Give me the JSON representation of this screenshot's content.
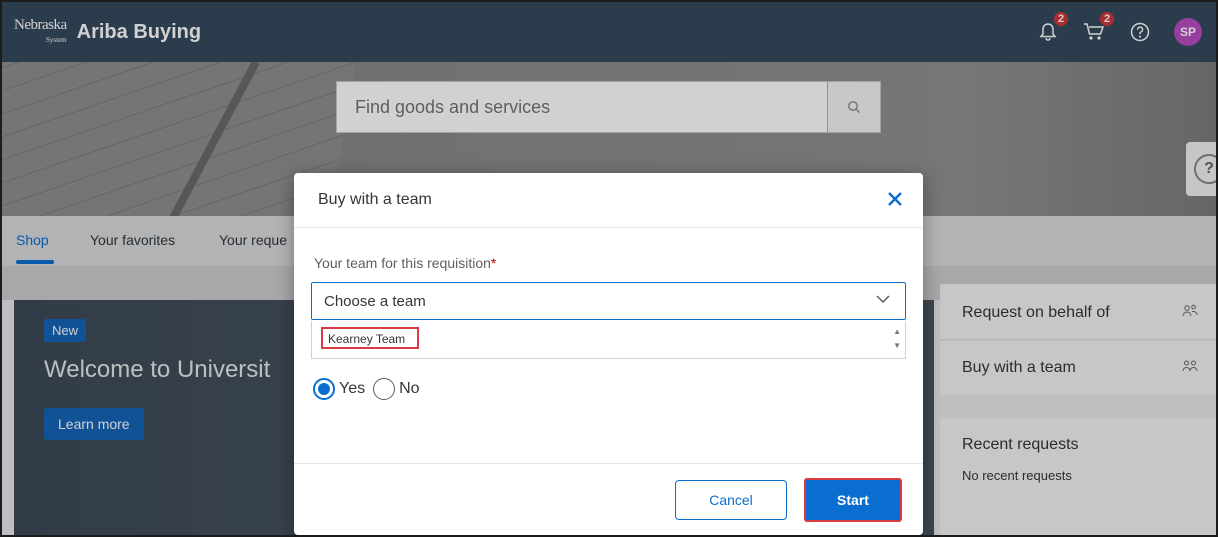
{
  "header": {
    "logo_text": "Nebraska",
    "logo_subtext": "System",
    "app_name": "Ariba Buying",
    "notifications_count": "2",
    "cart_count": "2",
    "avatar_initials": "SP"
  },
  "search": {
    "placeholder": "Find goods and services"
  },
  "nav": {
    "tabs": [
      "Shop",
      "Your favorites",
      "Your reque"
    ]
  },
  "banner": {
    "tag": "New",
    "welcome": "Welcome to Universit",
    "learn_more": "Learn more"
  },
  "right_panel": {
    "request_on_behalf": "Request on behalf of",
    "buy_with_team": "Buy with a team",
    "recent_title": "Recent requests",
    "recent_empty": "No recent requests"
  },
  "dialog": {
    "title": "Buy with a team",
    "field_label": "Your team for this requisition",
    "required_mark": "*",
    "select_value": "Choose a team",
    "option": "Kearney Team",
    "radio_yes": "Yes",
    "radio_no": "No",
    "cancel": "Cancel",
    "start": "Start"
  },
  "colors": {
    "shell": "#354a5f",
    "accent": "#0a6ed1",
    "highlight": "#d93b42",
    "avatar": "#b84cc0"
  }
}
